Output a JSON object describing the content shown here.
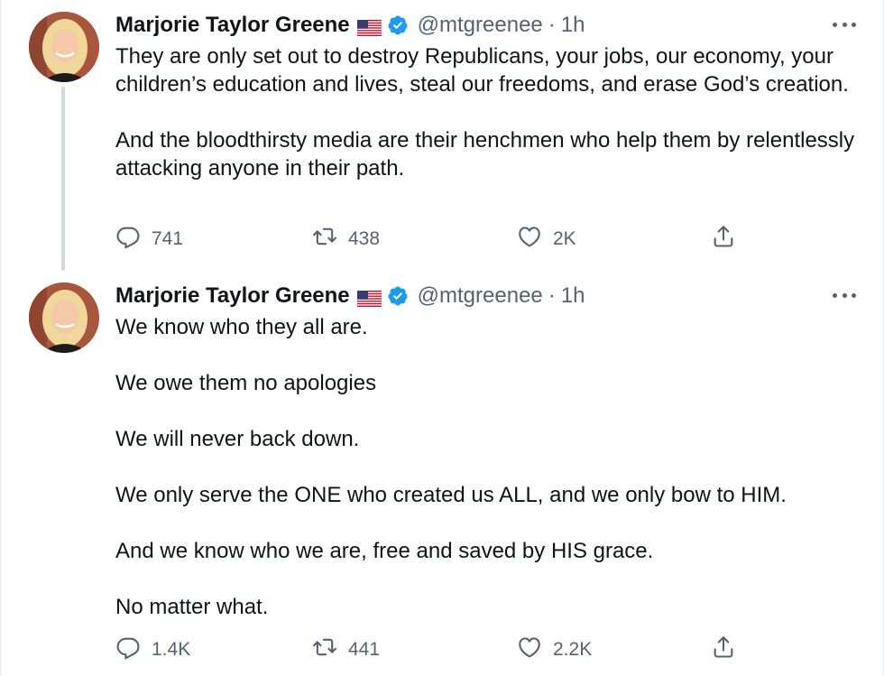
{
  "colors": {
    "text": "#0f1419",
    "secondary": "#536471",
    "verified": "#1d9bf0",
    "thread_line": "#cfd9de"
  },
  "tweets": [
    {
      "author_name": "Marjorie Taylor Greene",
      "flag_icon": "us-flag-icon",
      "verified_icon": "verified-badge-icon",
      "handle": "@mtgreenee",
      "separator": "·",
      "time": "1h",
      "paragraphs": [
        "They are only set out to destroy Republicans, your jobs, our economy, your children’s education and lives, steal our freedoms, and erase God’s creation.",
        "And the bloodthirsty media are their henchmen who help them by relentlessly attacking anyone in their path."
      ],
      "replies": "741",
      "retweets": "438",
      "likes": "2K"
    },
    {
      "author_name": "Marjorie Taylor Greene",
      "flag_icon": "us-flag-icon",
      "verified_icon": "verified-badge-icon",
      "handle": "@mtgreenee",
      "separator": "·",
      "time": "1h",
      "paragraphs": [
        "We know who they all are.",
        "We owe them no apologies",
        "We will never back down.",
        "We only serve the ONE who created us ALL, and we only bow to HIM.",
        "And we know who we are, free and saved by HIS grace.",
        "No matter what."
      ],
      "replies": "1.4K",
      "retweets": "441",
      "likes": "2.2K"
    }
  ]
}
